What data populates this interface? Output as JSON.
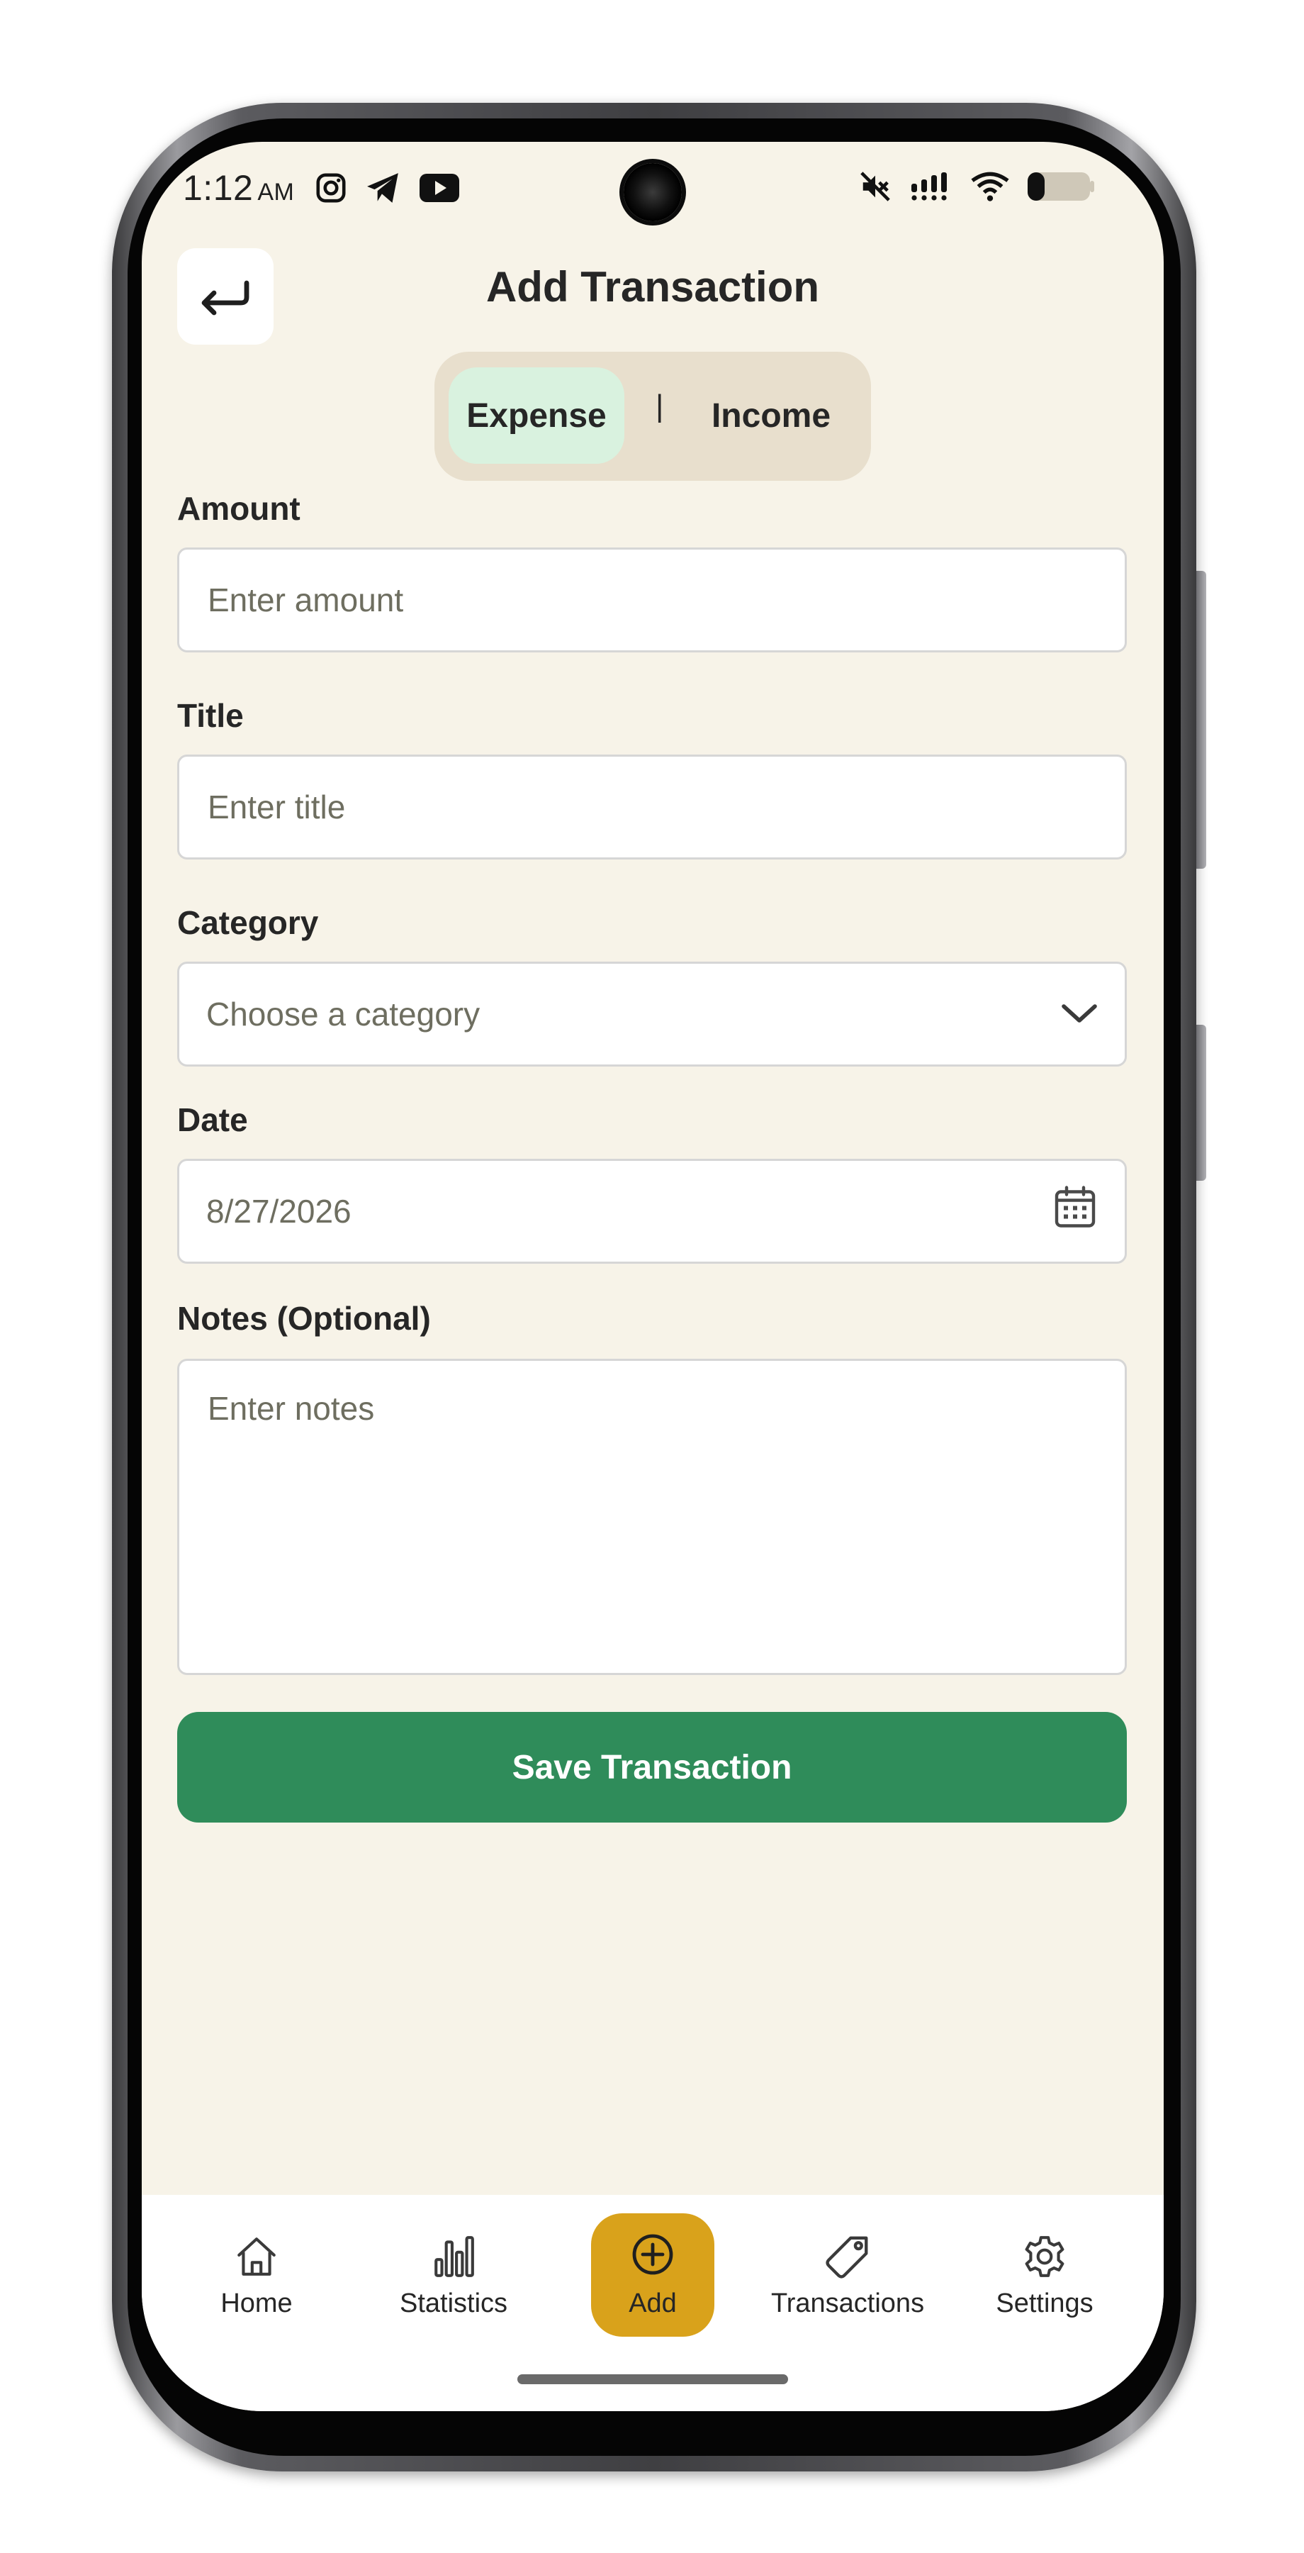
{
  "status_bar": {
    "time": "1:12",
    "ampm": "AM",
    "left_icons": [
      "instagram-icon",
      "telegram-icon",
      "youtube-icon"
    ],
    "right_icons": [
      "mute-icon",
      "signal-icon",
      "wifi-icon",
      "battery-icon"
    ]
  },
  "header": {
    "back_icon": "return-arrow-icon",
    "title": "Add Transaction"
  },
  "type_toggle": {
    "expense_label": "Expense",
    "divider": "|",
    "income_label": "Income",
    "selected": "Expense"
  },
  "form": {
    "amount": {
      "label": "Amount",
      "placeholder": "Enter amount",
      "value": ""
    },
    "title": {
      "label": "Title",
      "placeholder": "Enter title",
      "value": ""
    },
    "category": {
      "label": "Category",
      "placeholder": "Choose a category",
      "icon": "chevron-down-icon"
    },
    "date": {
      "label": "Date",
      "value": "8/27/2026",
      "icon": "calendar-icon"
    },
    "notes": {
      "label": "Notes (Optional)",
      "placeholder": "Enter notes",
      "value": ""
    },
    "save_label": "Save Transaction"
  },
  "bottom_nav": {
    "items": [
      {
        "label": "Home",
        "icon": "home-icon"
      },
      {
        "label": "Statistics",
        "icon": "bar-chart-icon"
      },
      {
        "label": "Add",
        "icon": "plus-circle-icon",
        "active": true
      },
      {
        "label": "Transactions",
        "icon": "tag-icon"
      },
      {
        "label": "Settings",
        "icon": "gear-icon"
      }
    ]
  },
  "colors": {
    "background": "#f7f3e8",
    "toggle_bg": "#e8dfcd",
    "toggle_active": "#d9f2df",
    "primary": "#2f8c5a",
    "accent": "#d9a21b",
    "text": "#262626",
    "placeholder": "#6e6e60"
  }
}
